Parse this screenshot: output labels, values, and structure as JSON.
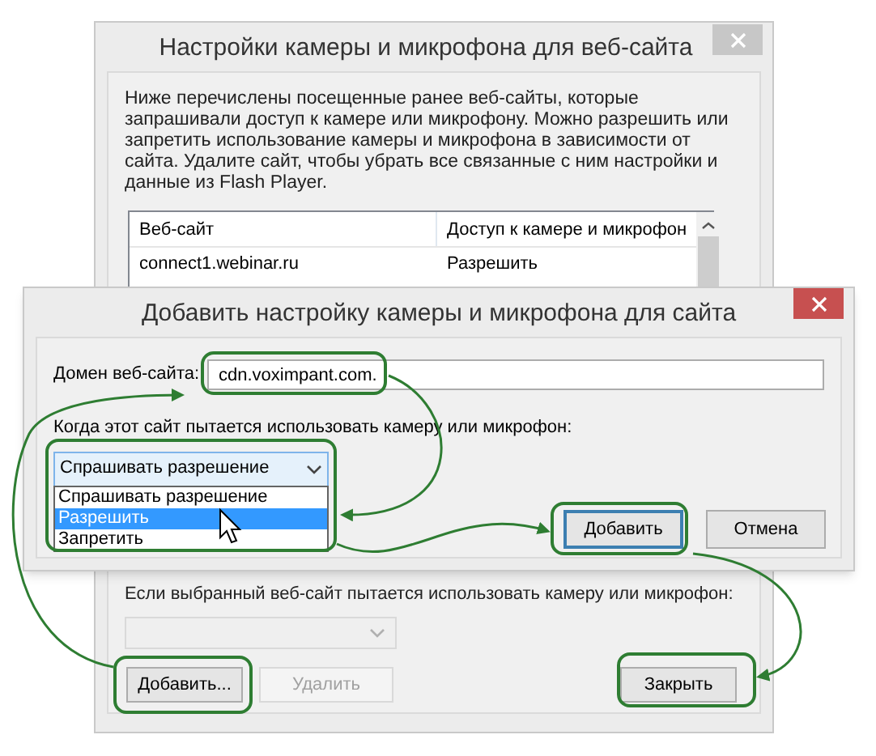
{
  "main_window": {
    "title": "Настройки камеры и микрофона для веб-сайта",
    "description": "Ниже перечислены посещенные ранее веб-сайты, которые запрашивали доступ к камере или микрофону. Можно разрешить или запретить использование камеры и микрофона в зависимости от сайта. Удалите сайт, чтобы убрать все связанные с ним настройки и данные из Flash Player.",
    "table": {
      "columns": [
        "Веб-сайт",
        "Доступ к камере и микрофон"
      ],
      "rows": [
        {
          "cells": [
            "connect1.webinar.ru",
            "Разрешить"
          ]
        }
      ]
    },
    "policy_label": "Если выбранный веб-сайт пытается использовать камеру или микрофон:",
    "policy_select": {
      "disabled": true
    },
    "buttons": [
      {
        "label": "Добавить...",
        "disabled": false,
        "kind": "left"
      },
      {
        "label": "Удалить",
        "disabled": true,
        "kind": "left"
      },
      {
        "label": "Закрыть",
        "disabled": false,
        "kind": "right"
      }
    ]
  },
  "add_dialog": {
    "title": "Добавить настройку камеры и микрофона для сайта",
    "domain_label": "Домен веб-сайта:",
    "domain_value": "cdn.voximpant.com.",
    "policy_label": "Когда этот сайт пытается использовать камеру или микрофон:",
    "select_value": "Спрашивать разрешение",
    "options": [
      {
        "label": "Спрашивать разрешение",
        "selected": false
      },
      {
        "label": "Разрешить",
        "selected": true
      },
      {
        "label": "Запретить",
        "selected": false
      }
    ],
    "buttons": [
      {
        "label": "Добавить",
        "default": true
      },
      {
        "label": "Отмена",
        "default": false
      }
    ]
  }
}
